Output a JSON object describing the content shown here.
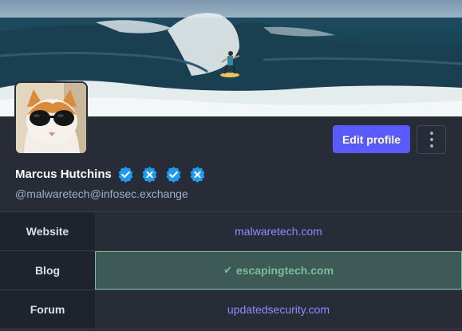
{
  "profile": {
    "display_name": "Marcus Hutchins",
    "username": "@malwaretech@infosec.exchange",
    "edit_button": "Edit profile",
    "badges": [
      {
        "icon": "verified-check-icon"
      },
      {
        "icon": "verified-x-icon"
      },
      {
        "icon": "verified-check-icon"
      },
      {
        "icon": "verified-x-icon"
      }
    ]
  },
  "fields": [
    {
      "name": "Website",
      "value": "malwaretech.com",
      "verified": false
    },
    {
      "name": "Blog",
      "value": "escapingtech.com",
      "verified": true
    },
    {
      "name": "Forum",
      "value": "updatedsecurity.com",
      "verified": false
    }
  ],
  "colors": {
    "accent": "#595aff",
    "background": "#282c37",
    "link": "#8c8dff",
    "verified": "#79bd9a",
    "badge": "#1d9bf0"
  }
}
